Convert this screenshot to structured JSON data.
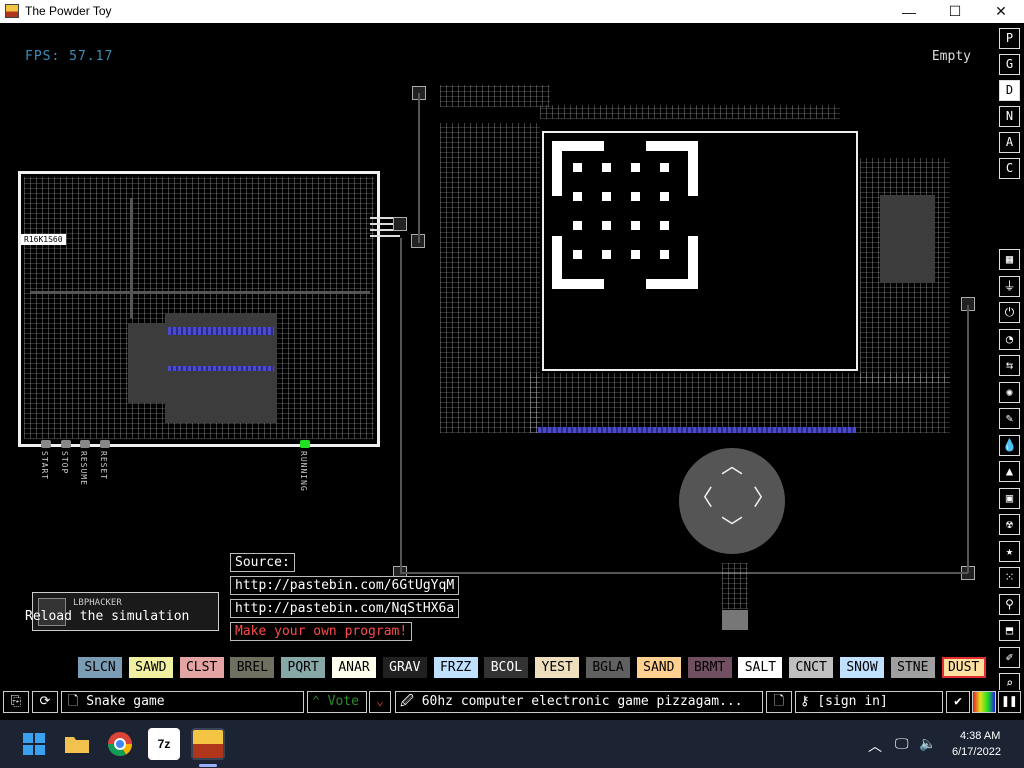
{
  "window": {
    "title": "The Powder Toy",
    "minimize": "—",
    "maximize": "☐",
    "close": "✕"
  },
  "sim": {
    "fps": "FPS: 57.17",
    "hover_element": "Empty",
    "chip_label": "R16K1S60",
    "board_labels": [
      "START",
      "STOP",
      "RESUME",
      "RESET"
    ],
    "running_label": "RUNNING"
  },
  "source_notes": {
    "heading": "Source:",
    "link1": "http://pastebin.com/6GtUgYqM",
    "link2": "http://pastebin.com/NqStHX6a",
    "cta": "Make your own program!"
  },
  "reload": {
    "tooltip": "Reload the simulation",
    "save_author": "LBPHACKER"
  },
  "right_menu": {
    "top": [
      "P",
      "G",
      "D",
      "N",
      "A",
      "C"
    ],
    "active_top": "D",
    "categories": [
      "walls-icon",
      "electronics-icon",
      "powered-icon",
      "sensors-icon",
      "force-icon",
      "explosives-icon",
      "gases-icon",
      "liquids-icon",
      "powders-icon",
      "solids-icon",
      "radioactive-icon",
      "special-icon",
      "life-icon",
      "tools-icon",
      "favorites-icon",
      "decoration-icon",
      "search-icon",
      "pause-icon"
    ]
  },
  "elements": [
    {
      "label": "SLCN",
      "bg": "#7a9cb4",
      "fg": "#000"
    },
    {
      "label": "SAWD",
      "bg": "#f0f0a0",
      "fg": "#000"
    },
    {
      "label": "CLST",
      "bg": "#e4a4a4",
      "fg": "#000"
    },
    {
      "label": "BREL",
      "bg": "#707060",
      "fg": "#000"
    },
    {
      "label": "PQRT",
      "bg": "#88a8a8",
      "fg": "#000"
    },
    {
      "label": "ANAR",
      "bg": "#ffffee",
      "fg": "#000"
    },
    {
      "label": "GRAV",
      "bg": "#202020",
      "fg": "#fff"
    },
    {
      "label": "FRZZ",
      "bg": "#c0e0ff",
      "fg": "#000"
    },
    {
      "label": "BCOL",
      "bg": "#333333",
      "fg": "#fff"
    },
    {
      "label": "YEST",
      "bg": "#eedebc",
      "fg": "#000"
    },
    {
      "label": "BGLA",
      "bg": "#606060",
      "fg": "#000"
    },
    {
      "label": "SAND",
      "bg": "#ffd090",
      "fg": "#000"
    },
    {
      "label": "BRMT",
      "bg": "#705060",
      "fg": "#000"
    },
    {
      "label": "SALT",
      "bg": "#ffffff",
      "fg": "#000"
    },
    {
      "label": "CNCT",
      "bg": "#c0c0c0",
      "fg": "#000"
    },
    {
      "label": "SNOW",
      "bg": "#c0e0ff",
      "fg": "#000"
    },
    {
      "label": "STNE",
      "bg": "#a0a0a0",
      "fg": "#000"
    },
    {
      "label": "DUST",
      "bg": "#ffe0a0",
      "fg": "#000"
    }
  ],
  "bottom": {
    "save_name": "Snake game",
    "vote": "Vote",
    "description": "60hz computer electronic game pizzagam...",
    "sign_in": "[sign in]"
  },
  "taskbar": {
    "time": "4:38 AM",
    "date": "6/17/2022"
  }
}
